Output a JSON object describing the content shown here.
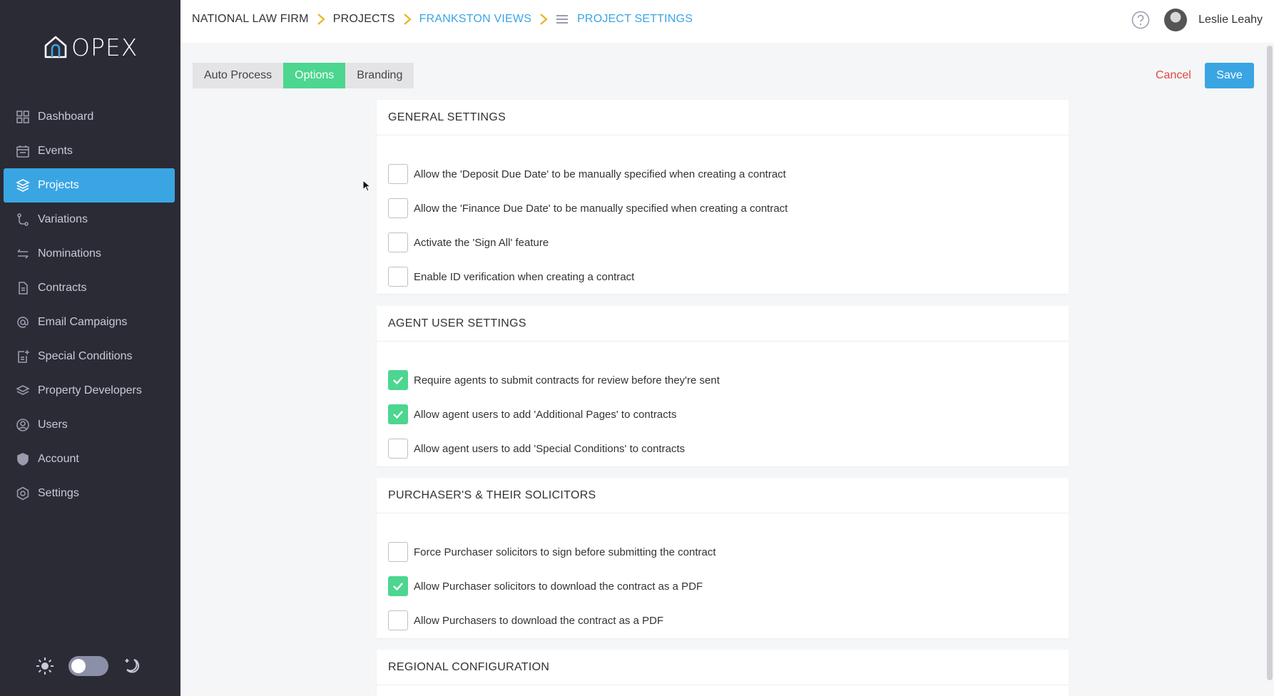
{
  "app": {
    "logo_text": "OPEX"
  },
  "sidebar": {
    "items": [
      {
        "label": "Dashboard",
        "icon": "dashboard-icon"
      },
      {
        "label": "Events",
        "icon": "calendar-icon"
      },
      {
        "label": "Projects",
        "icon": "layers-icon",
        "active": true
      },
      {
        "label": "Variations",
        "icon": "branch-icon"
      },
      {
        "label": "Nominations",
        "icon": "swap-icon"
      },
      {
        "label": "Contracts",
        "icon": "document-icon"
      },
      {
        "label": "Email Campaigns",
        "icon": "at-icon"
      },
      {
        "label": "Special Conditions",
        "icon": "document-plus-icon"
      },
      {
        "label": "Property Developers",
        "icon": "stack-icon"
      },
      {
        "label": "Users",
        "icon": "user-circle-icon"
      },
      {
        "label": "Account",
        "icon": "shield-icon"
      },
      {
        "label": "Settings",
        "icon": "gear-icon"
      }
    ],
    "theme_toggle": {
      "mode": "light"
    }
  },
  "breadcrumb": {
    "items": [
      "NATIONAL LAW FIRM",
      "PROJECTS",
      "FRANKSTON VIEWS",
      "PROJECT SETTINGS"
    ]
  },
  "user": {
    "name": "Leslie Leahy"
  },
  "tabs": [
    {
      "label": "Auto Process",
      "active": false
    },
    {
      "label": "Options",
      "active": true
    },
    {
      "label": "Branding",
      "active": false
    }
  ],
  "actions": {
    "cancel_label": "Cancel",
    "save_label": "Save"
  },
  "colors": {
    "accent": "#3aa5e3",
    "success": "#4cd68f",
    "danger": "#e0483f",
    "sidebar_bg": "#2b2b35"
  },
  "sections": [
    {
      "title": "GENERAL SETTINGS",
      "options": [
        {
          "label": "Allow the 'Deposit Due Date' to be manually specified when creating a contract",
          "checked": false
        },
        {
          "label": "Allow the 'Finance Due Date' to be manually specified when creating a contract",
          "checked": false
        },
        {
          "label": "Activate the 'Sign All' feature",
          "checked": false
        },
        {
          "label": "Enable ID verification when creating a contract",
          "checked": false
        }
      ]
    },
    {
      "title": "AGENT USER SETTINGS",
      "options": [
        {
          "label": "Require agents to submit contracts for review before they're sent",
          "checked": true
        },
        {
          "label": "Allow agent users to add 'Additional Pages' to contracts",
          "checked": true
        },
        {
          "label": "Allow agent users to add 'Special Conditions' to contracts",
          "checked": false
        }
      ]
    },
    {
      "title": "PURCHASER'S & THEIR SOLICITORS",
      "options": [
        {
          "label": "Force Purchaser solicitors to sign before submitting the contract",
          "checked": false
        },
        {
          "label": "Allow Purchaser solicitors to download the contract as a PDF",
          "checked": true
        },
        {
          "label": "Allow Purchasers to download the contract as a PDF",
          "checked": false
        }
      ]
    },
    {
      "title": "REGIONAL CONFIGURATION",
      "options": []
    }
  ]
}
